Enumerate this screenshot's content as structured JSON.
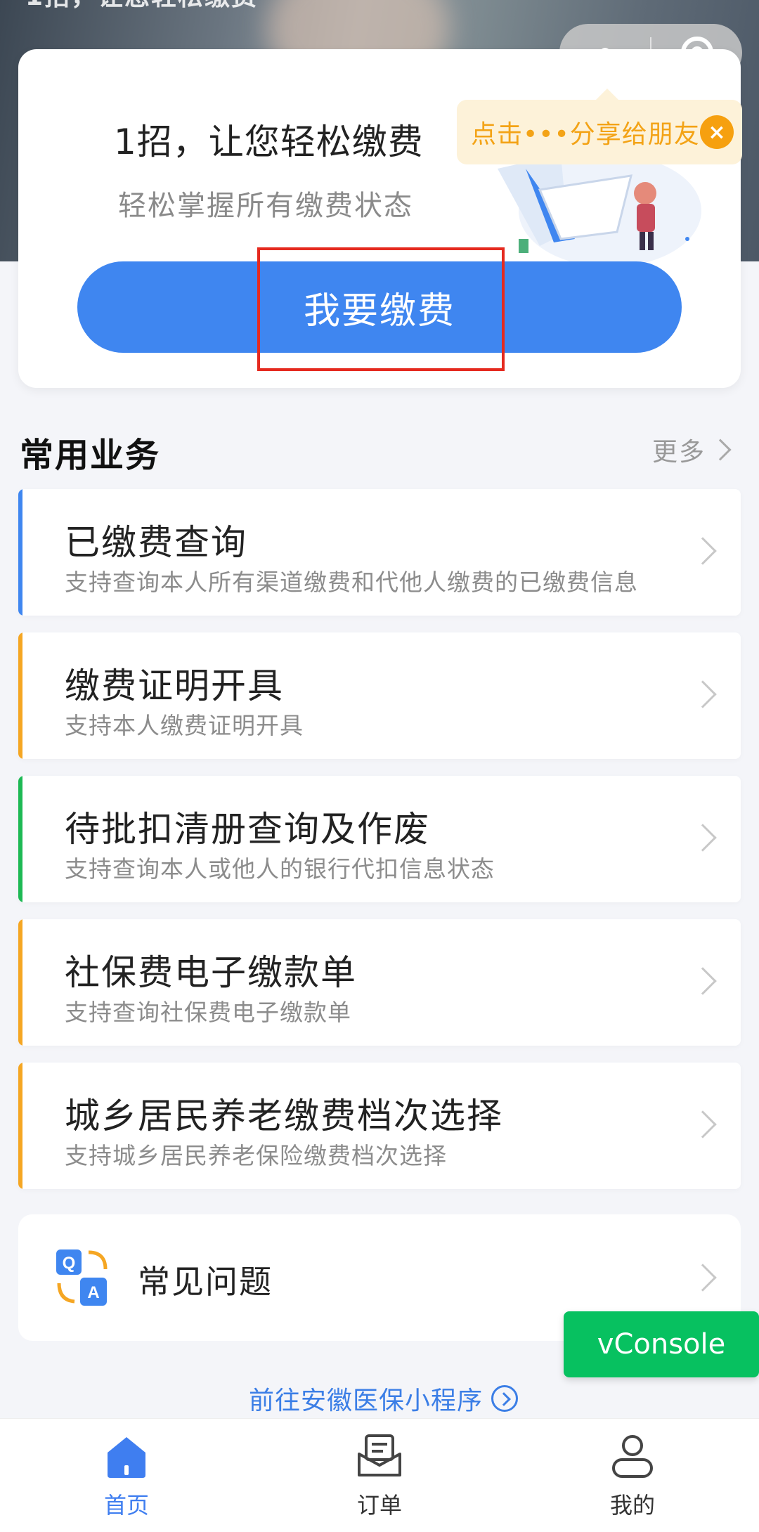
{
  "banner": {
    "slogan": "1招，让您轻松缴费"
  },
  "hero": {
    "title": "1招，让您轻松缴费",
    "subtitle": "轻松掌握所有缴费状态",
    "pay_button": "我要缴费"
  },
  "tooltip": {
    "text": "点击•••分享给朋友",
    "close": "×"
  },
  "section": {
    "title": "常用业务",
    "more": "更多"
  },
  "services": [
    {
      "title": "已缴费查询",
      "desc": "支持查询本人所有渠道缴费和代他人缴费的已缴费信息",
      "accent": "#3f86f0"
    },
    {
      "title": "缴费证明开具",
      "desc": "支持本人缴费证明开具",
      "accent": "#f5a623"
    },
    {
      "title": "待批扣清册查询及作废",
      "desc": "支持查询本人或他人的银行代扣信息状态",
      "accent": "#1db954"
    },
    {
      "title": "社保费电子缴款单",
      "desc": "支持查询社保费电子缴款单",
      "accent": "#f5a623"
    },
    {
      "title": "城乡居民养老缴费档次选择",
      "desc": "支持城乡居民养老保险缴费档次选择",
      "accent": "#f5a623"
    }
  ],
  "faq": {
    "label": "常见问题",
    "icon_q": "Q",
    "icon_a": "A"
  },
  "vconsole": {
    "label": "vConsole"
  },
  "link": {
    "text": "前往安徽医保小程序"
  },
  "tabs": [
    {
      "label": "首页",
      "icon": "home-icon",
      "active": true
    },
    {
      "label": "订单",
      "icon": "order-icon",
      "active": false
    },
    {
      "label": "我的",
      "icon": "user-icon",
      "active": false
    }
  ],
  "colors": {
    "primary": "#3f86f0",
    "orange": "#f5a623",
    "green": "#07c160"
  }
}
